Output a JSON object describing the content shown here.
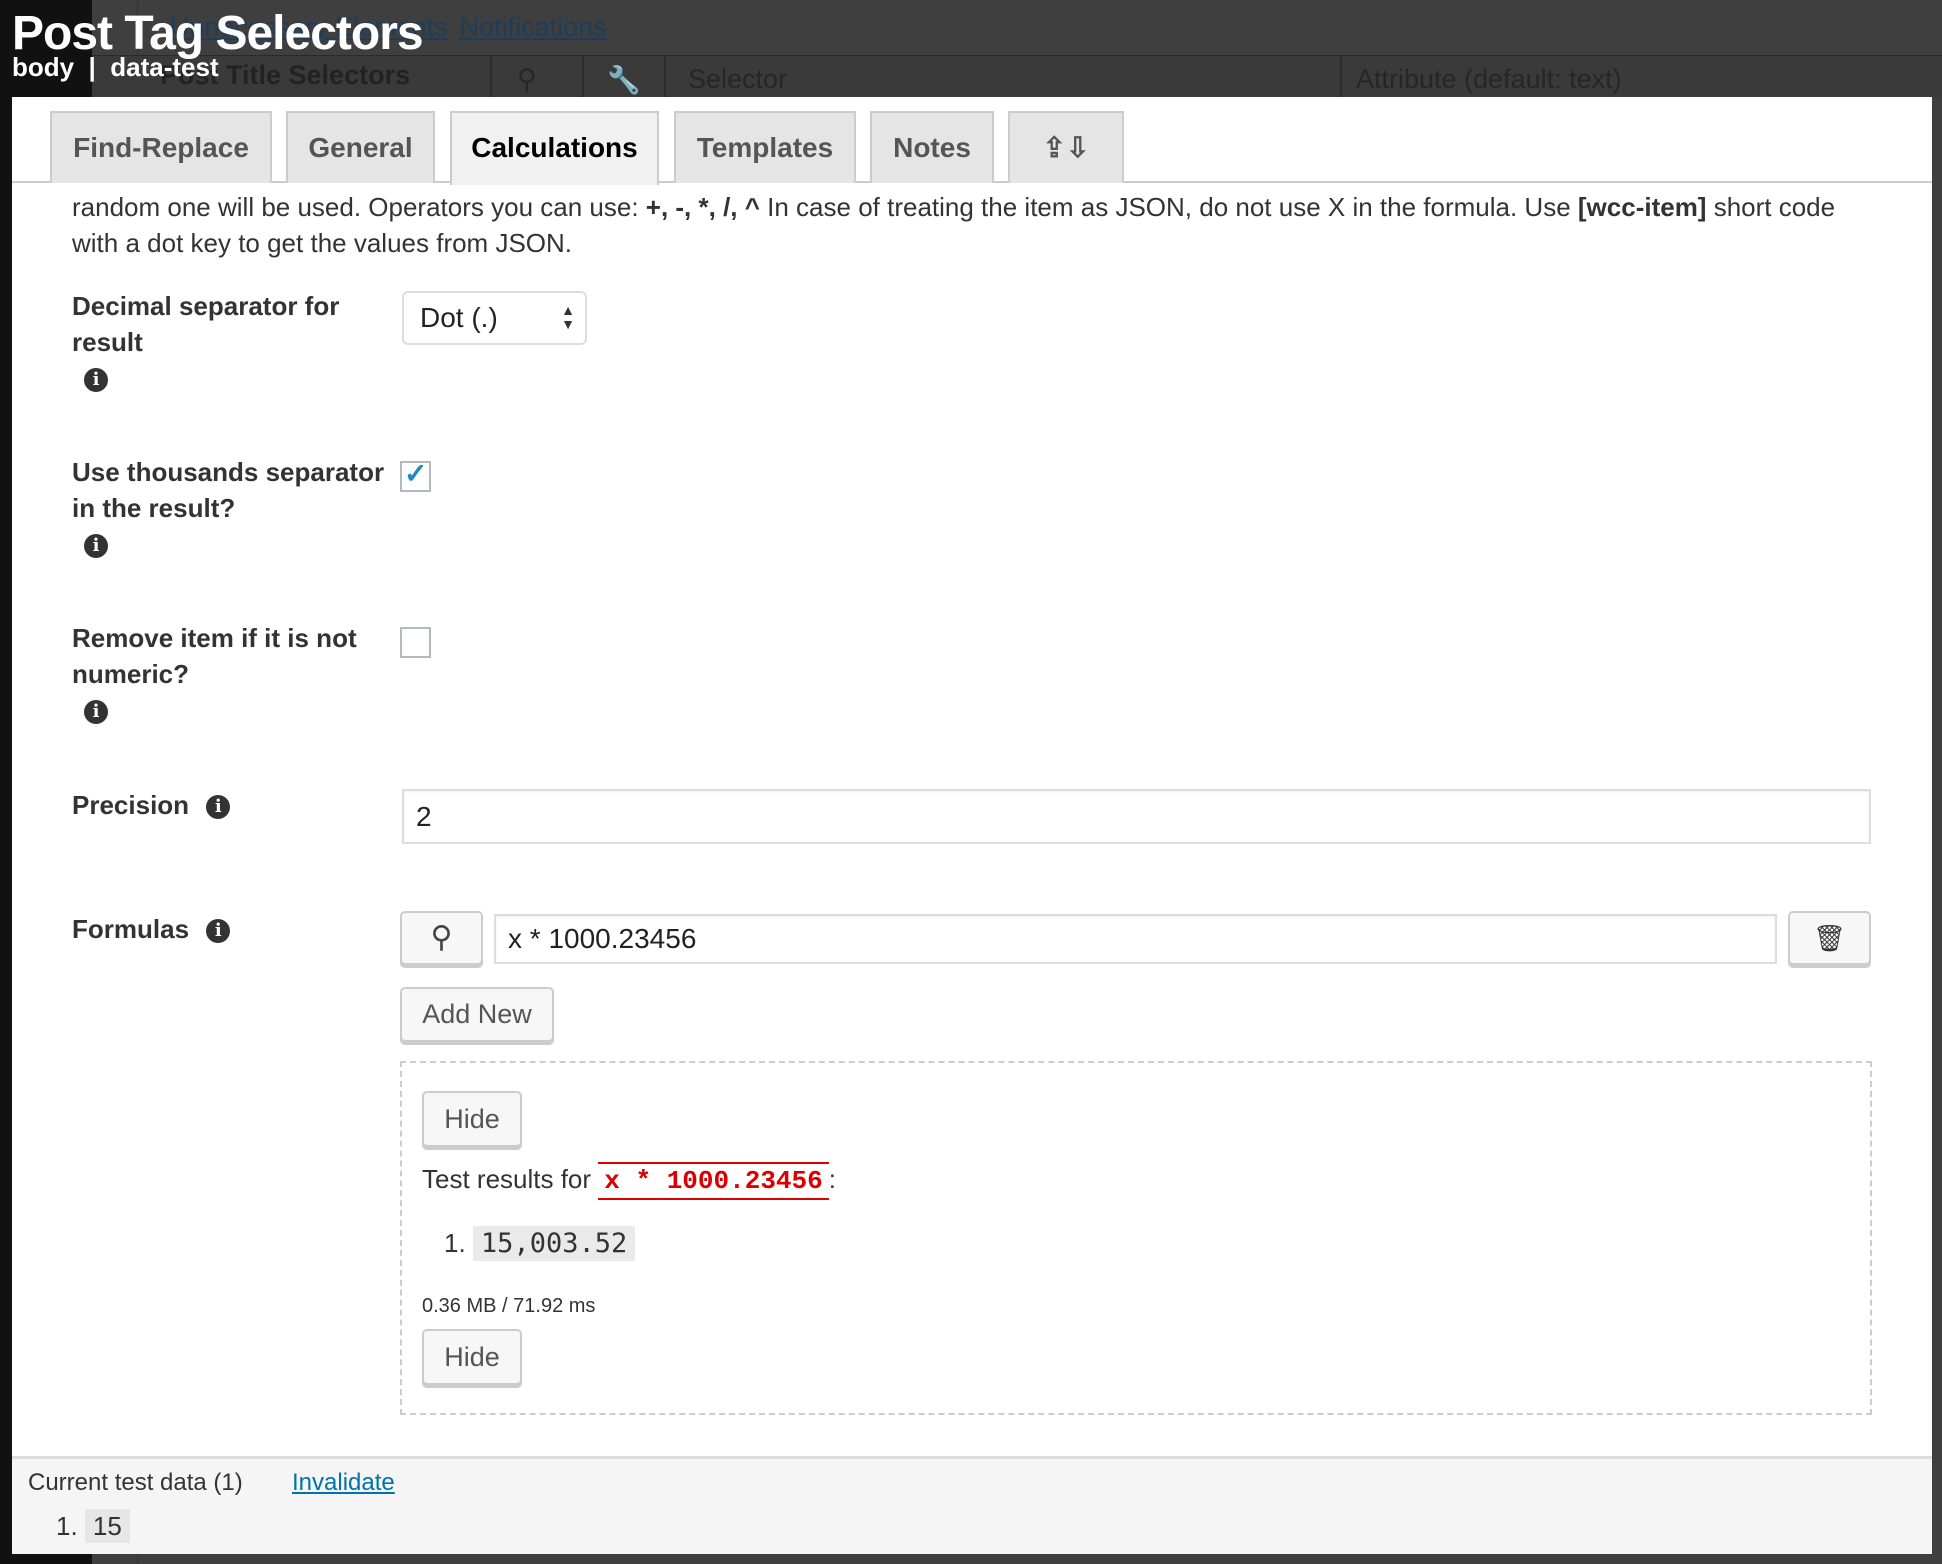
{
  "background": {
    "links": [
      "Unnecessary Elements",
      "Notifications"
    ],
    "row_label": "Post Title Selectors",
    "selector_placeholder": "Selector",
    "attribute_placeholder": "Attribute (default: text)"
  },
  "header": {
    "title": "Post Tag Selectors",
    "subtitle": "body  |  data-test"
  },
  "tabs": [
    {
      "label": "Find-Replace",
      "active": false
    },
    {
      "label": "General",
      "active": false
    },
    {
      "label": "Calculations",
      "active": true
    },
    {
      "label": "Templates",
      "active": false
    },
    {
      "label": "Notes",
      "active": false
    }
  ],
  "tab_icons": [
    "upload-icon",
    "download-icon"
  ],
  "description": {
    "line1_pre": "random one will be used. Operators you can use: ",
    "operators": "+, -, *, /, ^",
    "line1_mid": " In case of treating the item as JSON, do not use X in the formula. Use ",
    "shortcode": "[wcc-item]",
    "line1_post": " short code with a dot key to get the values from JSON."
  },
  "fields": {
    "decimal_separator": {
      "label": "Decimal separator for result",
      "value": "Dot (.)"
    },
    "thousands_separator": {
      "label": "Use thousands separator in the result?",
      "checked": true
    },
    "remove_non_numeric": {
      "label": "Remove item if it is not numeric?",
      "checked": false
    },
    "precision": {
      "label": "Precision",
      "value": "2"
    },
    "formulas": {
      "label": "Formulas",
      "values": [
        "x * 1000.23456"
      ],
      "add_new": "Add New"
    }
  },
  "test_results": {
    "hide_label": "Hide",
    "prefix": "Test results for",
    "formula": "x * 1000.23456",
    "suffix": ":",
    "results": [
      "15,003.52"
    ],
    "stats": "0.36 MB / 71.92 ms"
  },
  "footer": {
    "label": "Current test data (1)",
    "invalidate": "Invalidate",
    "items": [
      "15"
    ]
  },
  "colors": {
    "accent": "#0073aa",
    "error": "#dd0000",
    "checkbox": "#1e8cbe"
  }
}
